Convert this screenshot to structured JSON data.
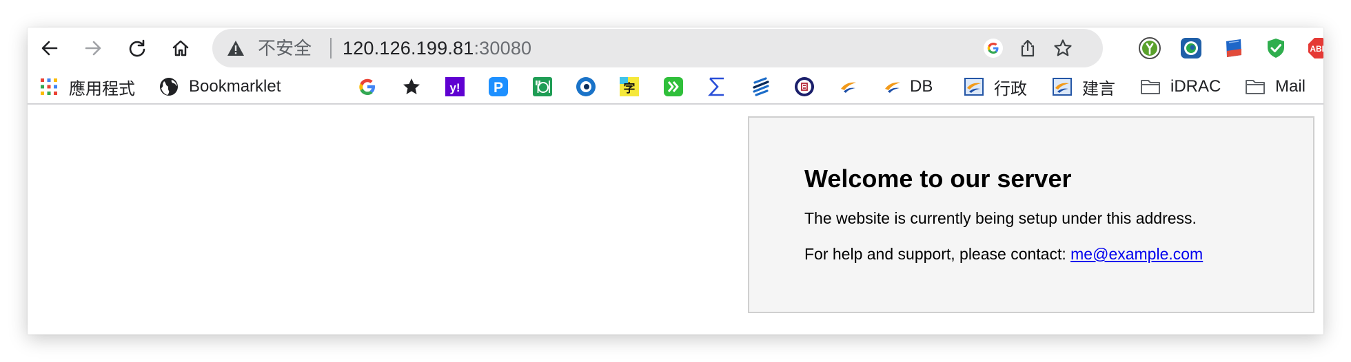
{
  "browser": {
    "nav": {
      "back_icon": "arrow-left-icon",
      "forward_icon": "arrow-right-icon",
      "reload_icon": "reload-icon",
      "home_icon": "home-icon"
    },
    "omnibox": {
      "security_icon": "warning-triangle-icon",
      "security_label": "不安全",
      "url_host": "120.126.199.81",
      "url_port": ":30080",
      "google_icon": "google-g-icon",
      "share_icon": "share-icon",
      "star_icon": "bookmark-star-icon"
    },
    "extensions": [
      {
        "icon": "green-runner-extension-icon"
      },
      {
        "icon": "blue-circle-extension-icon"
      },
      {
        "icon": "blue-notebook-extension-icon"
      },
      {
        "icon": "green-shield-extension-icon"
      },
      {
        "icon": "adblock-plus-icon",
        "text": "ABP"
      }
    ]
  },
  "bookmarks": [
    {
      "icon": "apps-grid-icon",
      "label": "應用程式"
    },
    {
      "icon": "globe-icon",
      "label": "Bookmarklet"
    },
    {
      "icon": "google-g-icon",
      "label": ""
    },
    {
      "icon": "star-icon",
      "label": ""
    },
    {
      "icon": "yahoo-icon",
      "text": "y!",
      "label": ""
    },
    {
      "icon": "parking-p-icon",
      "text": "P",
      "label": ""
    },
    {
      "icon": "green-restaurant-icon",
      "label": ""
    },
    {
      "icon": "eye-circle-icon",
      "label": ""
    },
    {
      "icon": "yellow-character-icon",
      "text": "字",
      "label": ""
    },
    {
      "icon": "green-double-chevron-icon",
      "label": ""
    },
    {
      "icon": "sigma-icon",
      "label": ""
    },
    {
      "icon": "blue-s-stripes-icon",
      "label": ""
    },
    {
      "icon": "seal-circle-icon",
      "label": ""
    },
    {
      "icon": "bird-logo-icon",
      "label": ""
    },
    {
      "icon": "bird-logo-icon",
      "label": "DB"
    },
    {
      "icon": "bird-square-icon",
      "label": "行政"
    },
    {
      "icon": "bird-square-icon",
      "label": "建言"
    },
    {
      "icon": "folder-icon",
      "label": "iDRAC"
    },
    {
      "icon": "folder-icon",
      "label": "Mail"
    }
  ],
  "page": {
    "title": "Welcome to our server",
    "line1": "The website is currently being setup under this address.",
    "line2_prefix": "For help and support, please contact: ",
    "contact_email": "me@example.com"
  }
}
